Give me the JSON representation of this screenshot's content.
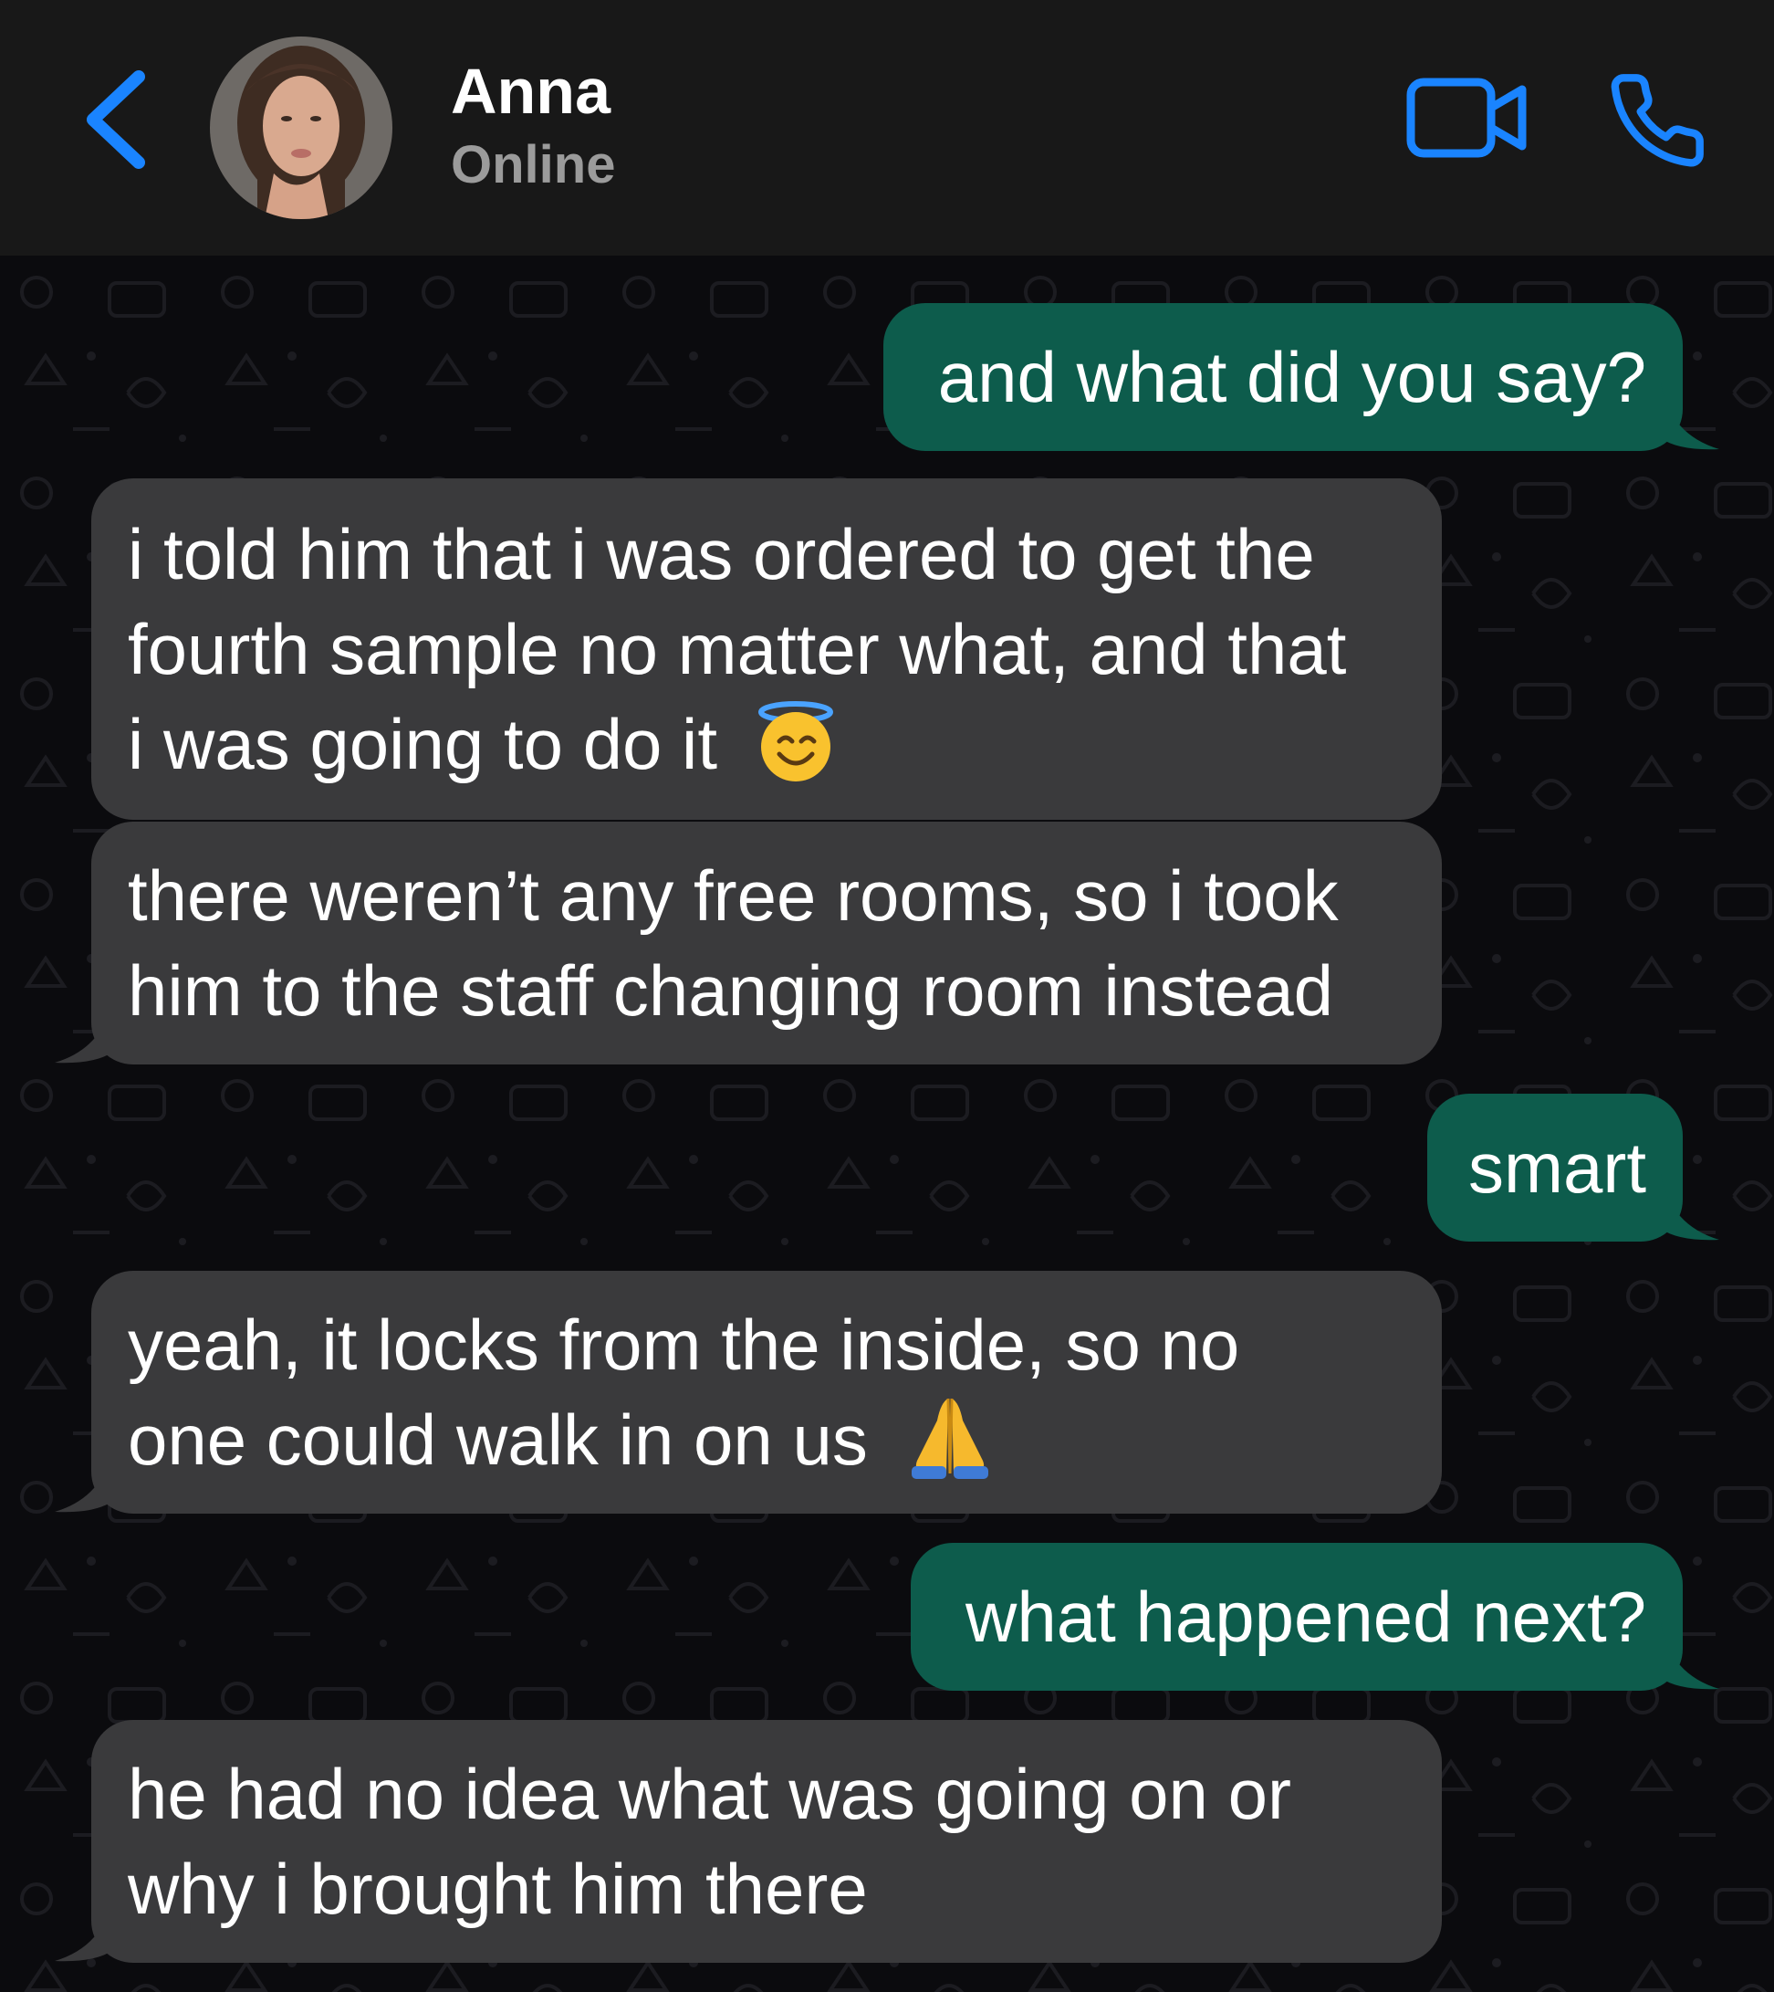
{
  "header": {
    "contact_name": "Anna",
    "status": "Online"
  },
  "colors": {
    "accent": "#1a84ff",
    "header_bg": "#181818",
    "chat_bg": "#0b0b0e",
    "outgoing_bubble": "#0d5c4c",
    "incoming_bubble": "#3a3a3c"
  },
  "icons": {
    "back": "chevron-left-icon",
    "video": "video-camera-icon",
    "phone": "phone-icon"
  },
  "messages": [
    {
      "direction": "outgoing",
      "lines": [
        "and what did you say?"
      ]
    },
    {
      "direction": "incoming",
      "lines": [
        "i told him that i was ordered to get the",
        "fourth sample no matter what, and that",
        "i was going to do it"
      ],
      "emoji": "smiling-face-with-halo"
    },
    {
      "direction": "incoming",
      "lines": [
        "there weren’t any free rooms, so i took",
        "him to the staff changing room instead"
      ]
    },
    {
      "direction": "outgoing",
      "lines": [
        "smart"
      ]
    },
    {
      "direction": "incoming",
      "lines": [
        "yeah, it locks from the inside, so no",
        "one could walk in on us"
      ],
      "emoji": "folded-hands"
    },
    {
      "direction": "outgoing",
      "lines": [
        "what happened next?"
      ]
    },
    {
      "direction": "incoming",
      "lines": [
        "he had no idea what was going on or",
        "why i brought him there"
      ]
    }
  ]
}
